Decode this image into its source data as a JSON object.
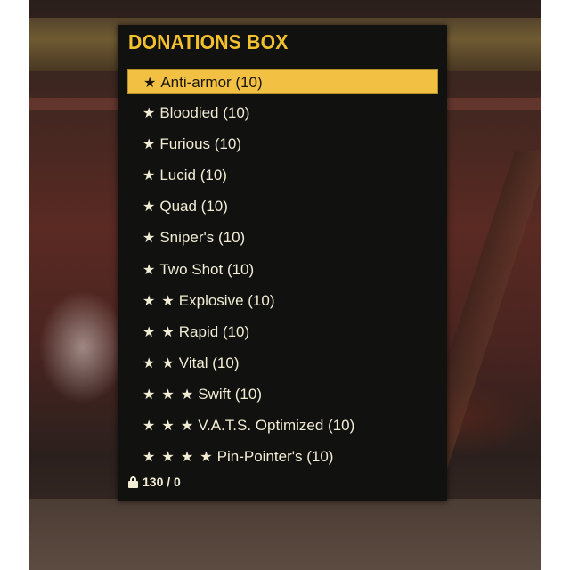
{
  "menu": {
    "title": "DONATIONS BOX",
    "items": [
      {
        "stars": "★",
        "label": "Anti-armor (10)",
        "selected": true
      },
      {
        "stars": "★",
        "label": "Bloodied (10)"
      },
      {
        "stars": "★",
        "label": "Furious (10)"
      },
      {
        "stars": "★",
        "label": "Lucid (10)"
      },
      {
        "stars": "★",
        "label": "Quad (10)"
      },
      {
        "stars": "★",
        "label": "Sniper's (10)"
      },
      {
        "stars": "★",
        "label": "Two Shot (10)"
      },
      {
        "stars": "★ ★",
        "label": "Explosive (10)"
      },
      {
        "stars": "★ ★",
        "label": "Rapid (10)"
      },
      {
        "stars": "★ ★",
        "label": "Vital (10)"
      },
      {
        "stars": "★ ★ ★",
        "label": "Swift (10)"
      },
      {
        "stars": "★ ★ ★",
        "label": "V.A.T.S. Optimized (10)"
      },
      {
        "stars": "★ ★ ★ ★",
        "label": "Pin-Pointer's (10)"
      }
    ]
  },
  "footer": {
    "icon": "lock-icon",
    "weight": "130 / 0"
  },
  "colors": {
    "accent": "#f2c12e",
    "selected_bg": "#f2c144",
    "panel_bg": "#111110",
    "text": "#f1ecd4"
  }
}
